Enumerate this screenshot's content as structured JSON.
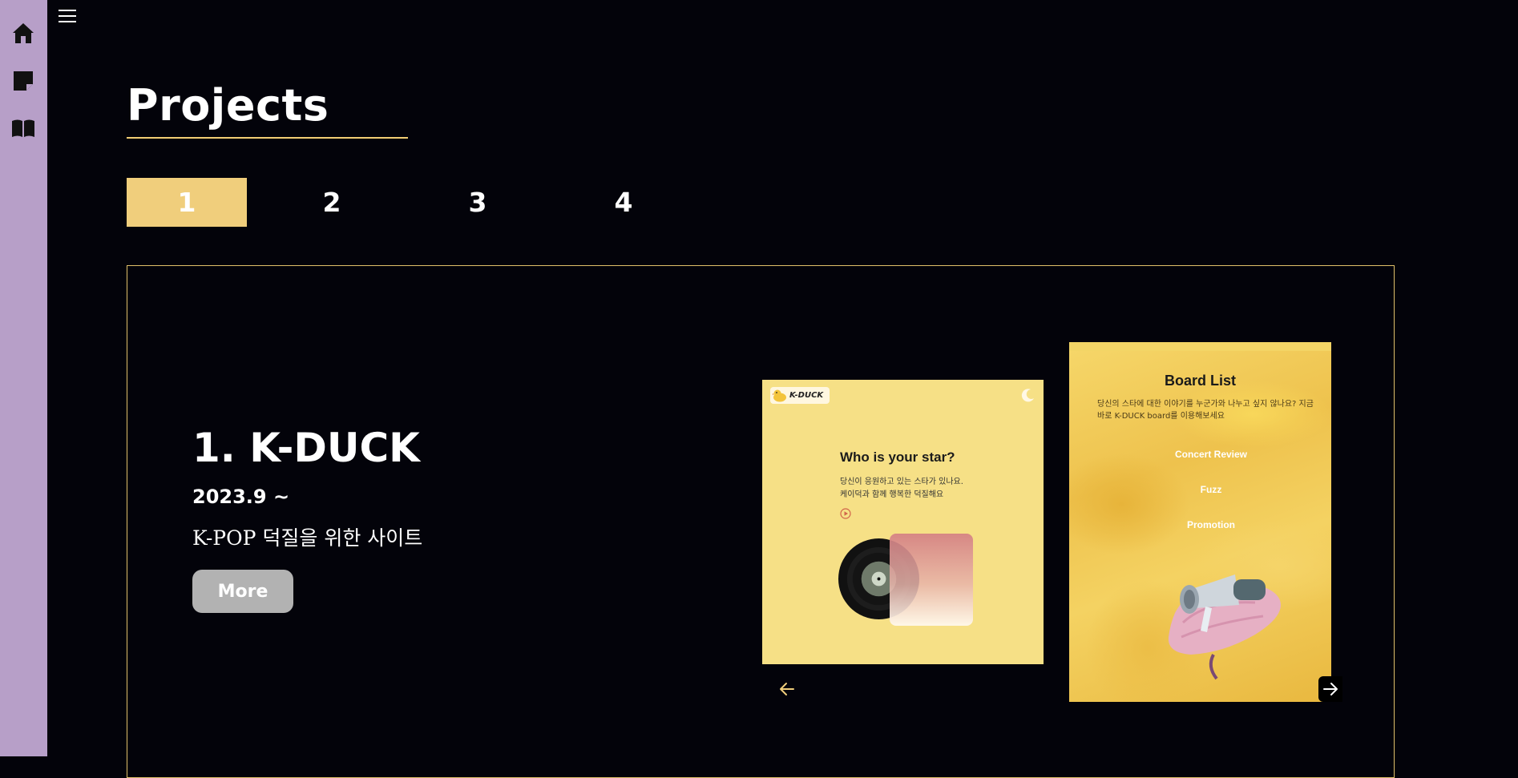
{
  "page": {
    "title": "Projects",
    "accent_color": "#f0ce7c",
    "sidebar_color": "#b79fc8",
    "background_color": "#03030a"
  },
  "sidebar": {
    "items": [
      {
        "icon": "home-icon"
      },
      {
        "icon": "note-icon"
      },
      {
        "icon": "book-icon"
      }
    ],
    "menu_icon": "hamburger-menu-icon"
  },
  "tabs": [
    {
      "label": "1",
      "active": true
    },
    {
      "label": "2",
      "active": false
    },
    {
      "label": "3",
      "active": false
    },
    {
      "label": "4",
      "active": false
    }
  ],
  "project": {
    "title": "1. K-DUCK",
    "date": "2023.9 ~",
    "description": "K-POP 덕질을 위한 사이트",
    "more_label": "More"
  },
  "slides": [
    {
      "logo_text": "K-DUCK",
      "heading": "Who is your star?",
      "description": "당신이 응원하고 있는 스타가 있나요.\n케이덕과 함께 행복한 덕질해요",
      "icons": [
        "duck-logo-icon",
        "moon-icon",
        "play-icon",
        "vinyl-record-icon"
      ]
    },
    {
      "heading": "Board List",
      "description": "당신의 스타에 대한 이야기를 누군가와 나누고 싶지 않나요? 지금 바로 K-DUCK board를 이용해보세요",
      "links": [
        "Concert Review",
        "Fuzz",
        "Promotion"
      ],
      "icons": [
        "megaphone-icon"
      ]
    }
  ],
  "carousel": {
    "prev_icon": "arrow-left-icon",
    "next_icon": "arrow-right-icon"
  }
}
